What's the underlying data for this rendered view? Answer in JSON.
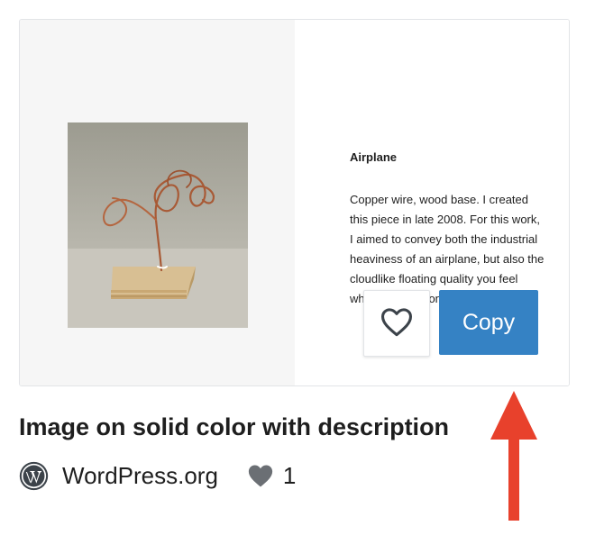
{
  "preview": {
    "image_alt": "Copper wire sculpture on a wood base",
    "title": "Airplane",
    "description": "Copper wire, wood base. I created this piece in late 2008. For this work, I aimed to convey both the industrial heaviness of an airplane, but also the cloudlike floating quality you feel when you’re in one."
  },
  "actions": {
    "favorite_icon": "heart-outline-icon",
    "copy_label": "Copy"
  },
  "pattern": {
    "title": "Image on solid color with description",
    "author": "WordPress.org",
    "author_icon": "wordpress-logo-icon",
    "like_icon": "heart-icon",
    "like_count": "1"
  },
  "annotation": {
    "arrow_icon": "red-up-arrow-icon",
    "arrow_color": "#e8412c"
  },
  "colors": {
    "accent": "#3582c4",
    "preview_left_bg": "#f6f6f6"
  }
}
